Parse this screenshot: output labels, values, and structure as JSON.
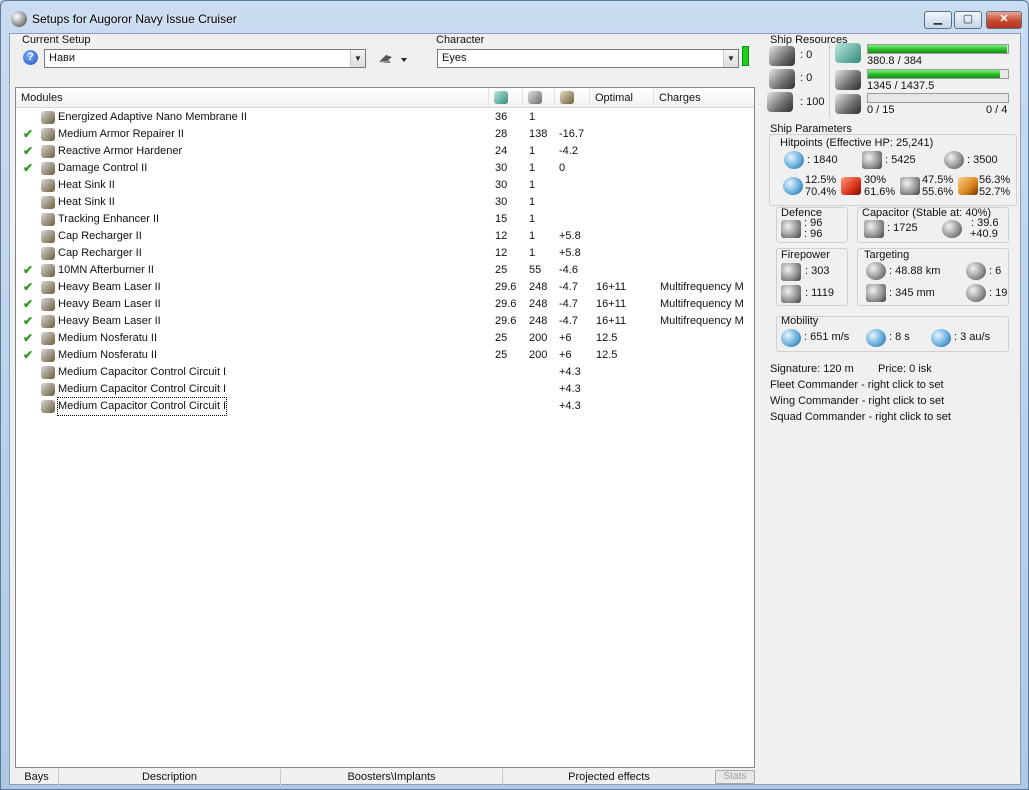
{
  "window": {
    "title": "Setups for Augoror Navy Issue Cruiser",
    "min_label": "▁",
    "max_label": "▢",
    "close_label": "✕"
  },
  "setup": {
    "label": "Current Setup",
    "value": "Нави",
    "help_label": "?"
  },
  "character": {
    "label": "Character",
    "value": "Eyes"
  },
  "modules": {
    "headers": {
      "name": "Modules",
      "optimal": "Optimal",
      "charges": "Charges"
    },
    "rows": [
      {
        "checked": "",
        "name": "Energized Adaptive Nano Membrane II",
        "cpu": "36",
        "pg": "1",
        "cap": "",
        "optimal": "",
        "charges": ""
      },
      {
        "checked": "✔",
        "name": "Medium Armor Repairer II",
        "cpu": "28",
        "pg": "138",
        "cap": "-16.7",
        "optimal": "",
        "charges": ""
      },
      {
        "checked": "✔",
        "name": "Reactive Armor Hardener",
        "cpu": "24",
        "pg": "1",
        "cap": "-4.2",
        "optimal": "",
        "charges": ""
      },
      {
        "checked": "✔",
        "name": "Damage Control II",
        "cpu": "30",
        "pg": "1",
        "cap": "0",
        "optimal": "",
        "charges": ""
      },
      {
        "checked": "",
        "name": "Heat Sink II",
        "cpu": "30",
        "pg": "1",
        "cap": "",
        "optimal": "",
        "charges": ""
      },
      {
        "checked": "",
        "name": "Heat Sink II",
        "cpu": "30",
        "pg": "1",
        "cap": "",
        "optimal": "",
        "charges": ""
      },
      {
        "checked": "",
        "name": "Tracking Enhancer II",
        "cpu": "15",
        "pg": "1",
        "cap": "",
        "optimal": "",
        "charges": ""
      },
      {
        "checked": "",
        "name": "Cap Recharger II",
        "cpu": "12",
        "pg": "1",
        "cap": "+5.8",
        "optimal": "",
        "charges": ""
      },
      {
        "checked": "",
        "name": "Cap Recharger II",
        "cpu": "12",
        "pg": "1",
        "cap": "+5.8",
        "optimal": "",
        "charges": ""
      },
      {
        "checked": "✔",
        "name": "10MN Afterburner II",
        "cpu": "25",
        "pg": "55",
        "cap": "-4.6",
        "optimal": "",
        "charges": ""
      },
      {
        "checked": "✔",
        "name": "Heavy Beam Laser II",
        "cpu": "29.6",
        "pg": "248",
        "cap": "-4.7",
        "optimal": "16+11",
        "charges": "Multifrequency M"
      },
      {
        "checked": "✔",
        "name": "Heavy Beam Laser II",
        "cpu": "29.6",
        "pg": "248",
        "cap": "-4.7",
        "optimal": "16+11",
        "charges": "Multifrequency M"
      },
      {
        "checked": "✔",
        "name": "Heavy Beam Laser II",
        "cpu": "29.6",
        "pg": "248",
        "cap": "-4.7",
        "optimal": "16+11",
        "charges": "Multifrequency M"
      },
      {
        "checked": "✔",
        "name": "Medium Nosferatu II",
        "cpu": "25",
        "pg": "200",
        "cap": "+6",
        "optimal": "12.5",
        "charges": ""
      },
      {
        "checked": "✔",
        "name": "Medium Nosferatu II",
        "cpu": "25",
        "pg": "200",
        "cap": "+6",
        "optimal": "12.5",
        "charges": ""
      },
      {
        "checked": "",
        "name": "Medium Capacitor Control Circuit I",
        "cpu": "",
        "pg": "",
        "cap": "+4.3",
        "optimal": "",
        "charges": ""
      },
      {
        "checked": "",
        "name": "Medium Capacitor Control Circuit I",
        "cpu": "",
        "pg": "",
        "cap": "+4.3",
        "optimal": "",
        "charges": ""
      },
      {
        "checked": "",
        "name": "Medium Capacitor Control Circuit I",
        "cpu": "",
        "pg": "",
        "cap": "+4.3",
        "optimal": "",
        "charges": ""
      }
    ]
  },
  "bottom_tabs": {
    "bays": "Bays",
    "description": "Description",
    "boosters": "Boosters\\Implants",
    "projected": "Projected effects",
    "stats": "Stats"
  },
  "resources": {
    "label": "Ship Resources",
    "turrets": ": 0",
    "launchers": ": 0",
    "calibration": ": 100",
    "cpu_text": "380.8 / 384",
    "cpu_fraction": 0.99,
    "pg_text": "1345 / 1437.5",
    "pg_fraction": 0.94,
    "drones_text": "0 / 15",
    "drones_fraction": 0,
    "drones_active": "0 / 4"
  },
  "params": {
    "label": "Ship Parameters",
    "hitpoints_label": "Hitpoints (Effective HP: 25,241)",
    "shield_hp": ": 1840",
    "armor_hp": ": 5425",
    "structure_hp": ": 3500",
    "res_em": [
      "12.5%",
      "70.4%"
    ],
    "res_thermal": [
      "30%",
      "61.6%"
    ],
    "res_kinetic": [
      "47.5%",
      "55.6%"
    ],
    "res_explosive": [
      "56.3%",
      "52.7%"
    ],
    "defence_label": "Defence",
    "defence_1": ": 96",
    "defence_2": ": 96",
    "capacitor_label": "Capacitor (Stable at: 40%)",
    "capacitor_amount": ": 1725",
    "capacitor_recharge": ": 39.6",
    "capacitor_delta": "+40.9",
    "firepower_label": "Firepower",
    "firepower_dps": ": 303",
    "firepower_volley": ": 1119",
    "targeting_label": "Targeting",
    "targeting_range": ": 48.88 km",
    "targeting_targets": ": 6",
    "targeting_scan": ": 345 mm",
    "targeting_sensor": ": 19",
    "mobility_label": "Mobility",
    "mobility_speed": ": 651 m/s",
    "mobility_align": ": 8 s",
    "mobility_warp": ": 3 au/s",
    "signature": "Signature: 120 m",
    "price": "Price: 0 isk",
    "fleet_commander": "Fleet Commander - right click to set",
    "wing_commander": "Wing Commander - right click to set",
    "squad_commander": "Squad Commander - right click to set"
  }
}
